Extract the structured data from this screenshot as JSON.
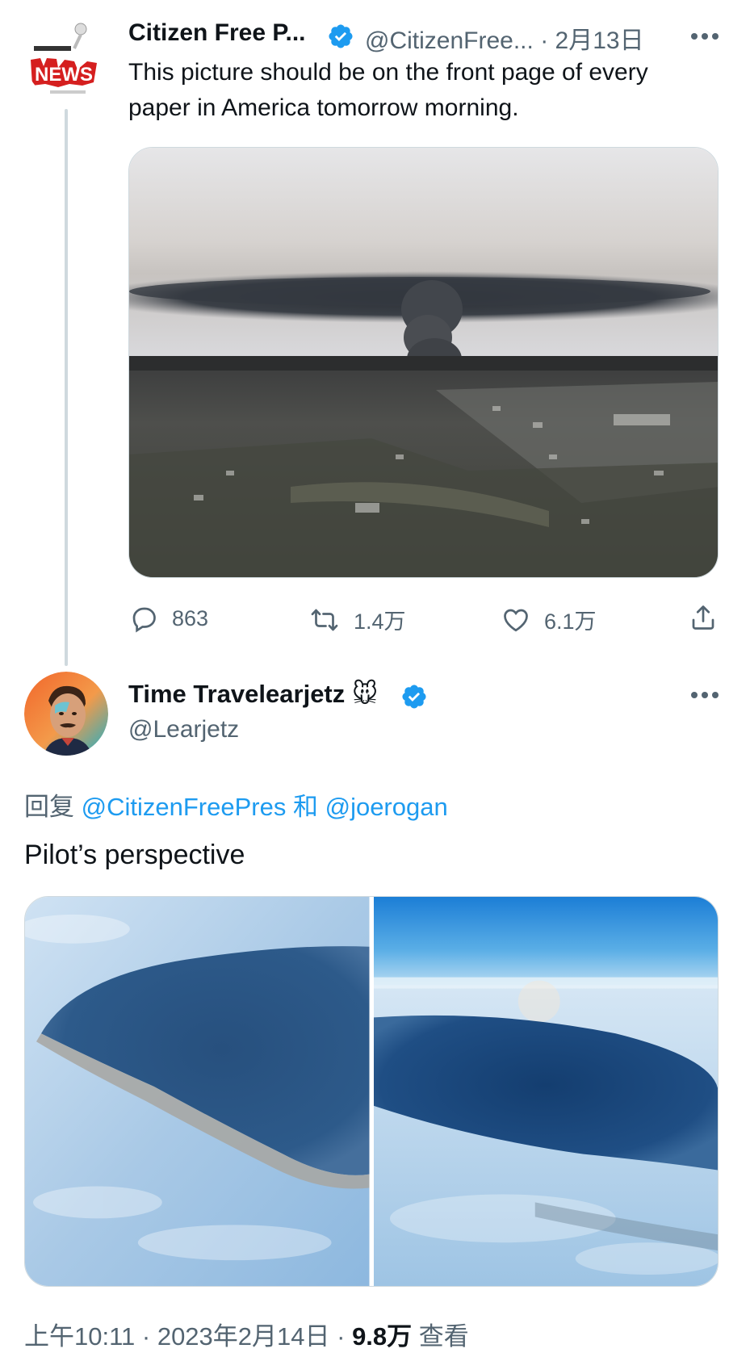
{
  "tweet1": {
    "display_name": "Citizen Free P...",
    "handle": "@CitizenFree...",
    "date": "· 2月13日",
    "text": "This picture should be on the front page of every paper in America tomorrow morning.",
    "avatar_text": "NEWS",
    "replies": "863",
    "retweets": "1.4万",
    "likes": "6.1万"
  },
  "tweet2": {
    "display_name": "Time Travelearjetz",
    "emoji": "🐭",
    "handle": "@Learjetz",
    "reply_prefix": "回复",
    "reply_user1": "@CitizenFreePres",
    "reply_and": "和",
    "reply_user2": "@joerogan",
    "text": "Pilot’s perspective",
    "time": "上午10:11 · 2023年2月14日 · ",
    "views_count": "9.8万",
    "views_label": "查看"
  },
  "colors": {
    "accent": "#1d9bf0",
    "secondary_text": "#536471",
    "primary_text": "#0f1419",
    "thread_line": "#cfd9de"
  },
  "icons": [
    "verified-badge-icon",
    "more-icon",
    "reply-icon",
    "retweet-icon",
    "like-icon",
    "share-icon"
  ]
}
